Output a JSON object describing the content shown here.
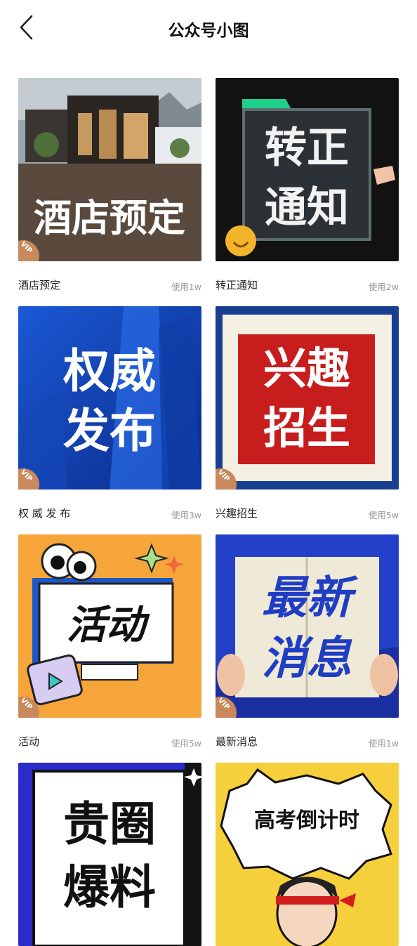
{
  "header": {
    "title": "公众号小图",
    "back_icon": "chevron-left-icon"
  },
  "vip_label": "VIP",
  "cards": [
    {
      "name": "酒店预定",
      "usage": "使用1w",
      "art_lines": [
        "酒店预定"
      ]
    },
    {
      "name": "转正通知",
      "usage": "使用2w",
      "art_lines": [
        "转正",
        "通知"
      ]
    },
    {
      "name": "权 威 发 布",
      "usage": "使用3w",
      "art_lines": [
        "权威",
        "发布"
      ]
    },
    {
      "name": "兴趣招生",
      "usage": "使用5w",
      "art_lines": [
        "兴趣",
        "招生"
      ]
    },
    {
      "name": "活动",
      "usage": "使用5w",
      "art_lines": [
        "活动"
      ]
    },
    {
      "name": "最新消息",
      "usage": "使用1w",
      "art_lines": [
        "最新",
        "消息"
      ]
    },
    {
      "art_lines": [
        "贵圈",
        "爆料"
      ]
    },
    {
      "art_lines": [
        "高考倒计时"
      ]
    }
  ]
}
